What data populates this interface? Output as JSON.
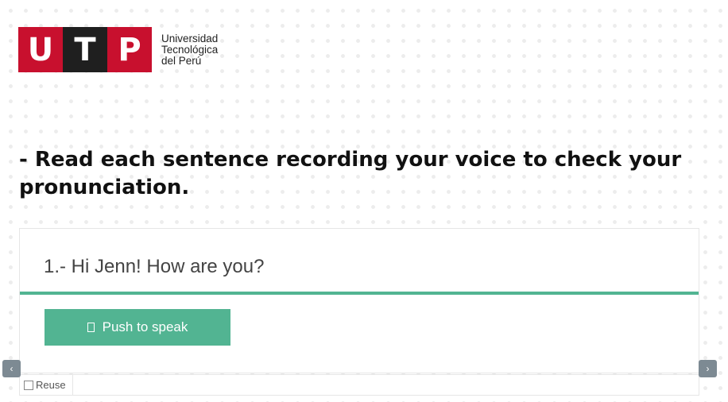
{
  "logo": {
    "letters": [
      "U",
      "T",
      "P"
    ],
    "lines": [
      "Universidad",
      "Tecnológica",
      "del Perú"
    ],
    "colors": {
      "red": "#c8102e",
      "dark": "#1f1f1f"
    }
  },
  "instruction": "- Read each sentence recording your voice to check your pronunciation.",
  "exercise": {
    "sentence": "1.- Hi Jenn! How are you?",
    "button_label": "Push to speak",
    "button_icon": "microphone-icon",
    "accent_color": "#52b492"
  },
  "footer": {
    "reuse_label": "Reuse",
    "reuse_checked": false
  },
  "nav": {
    "prev": "‹",
    "next": "›"
  }
}
